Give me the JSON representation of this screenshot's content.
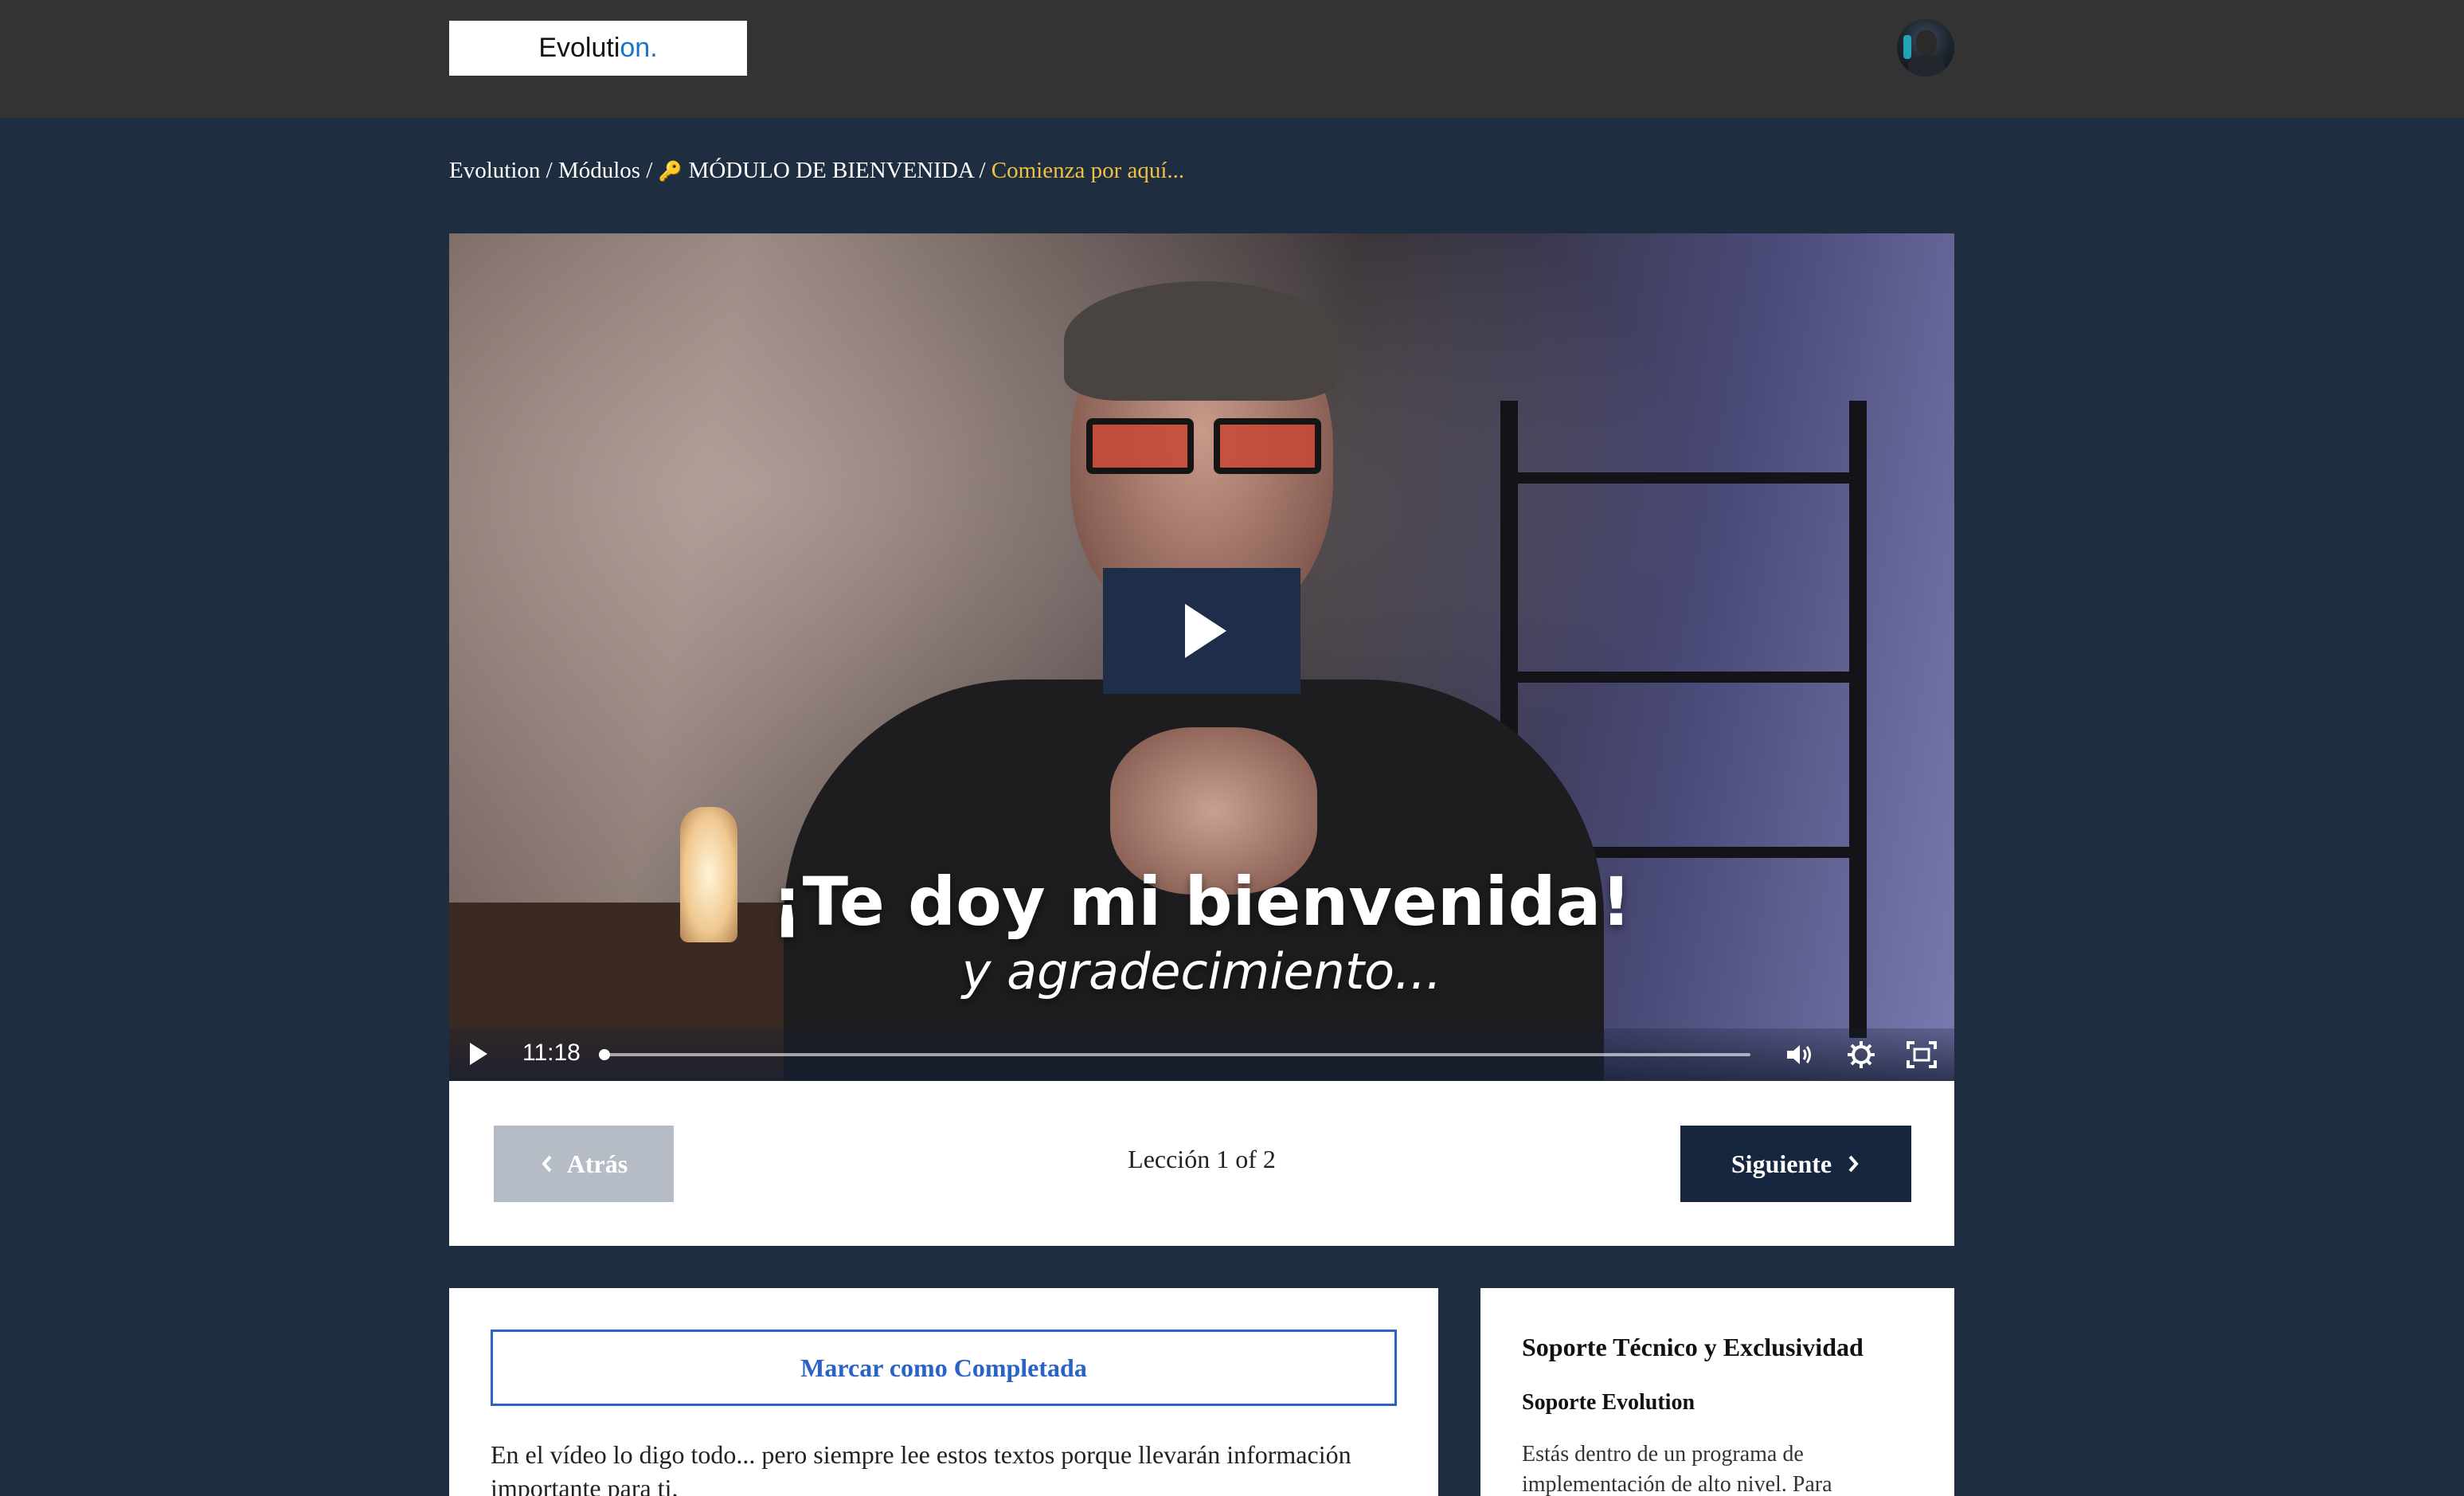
{
  "header": {
    "logo_text_main": "Evoluti",
    "logo_text_accent": "on."
  },
  "breadcrumb": {
    "item1": "Evolution",
    "item2": "Módulos",
    "item3": "MÓDULO DE BIENVENIDA",
    "current": "Comienza por aquí..."
  },
  "video": {
    "caption_line1": "¡Te doy mi bienvenida!",
    "caption_line2": "y agradecimiento...",
    "time": "11:18"
  },
  "lesson_nav": {
    "back_label": "Atrás",
    "counter": "Lección 1 of 2",
    "next_label": "Siguiente"
  },
  "content": {
    "complete_label": "Marcar como Completada",
    "body": "En el vídeo lo digo todo... pero siempre lee estos textos porque llevarán información importante para ti."
  },
  "sidebar": {
    "title": "Soporte Técnico y Exclusividad",
    "subtitle": "Soporte Evolution",
    "text": "Estás dentro de un programa de implementación de alto nivel. Para"
  },
  "colors": {
    "page_bg": "#1e2d40",
    "topbar_bg": "#333333",
    "accent_blue": "#2a63c7",
    "breadcrumb_current": "#f0c040",
    "next_button_bg": "#17263f",
    "back_button_bg": "#b5bcc6"
  }
}
